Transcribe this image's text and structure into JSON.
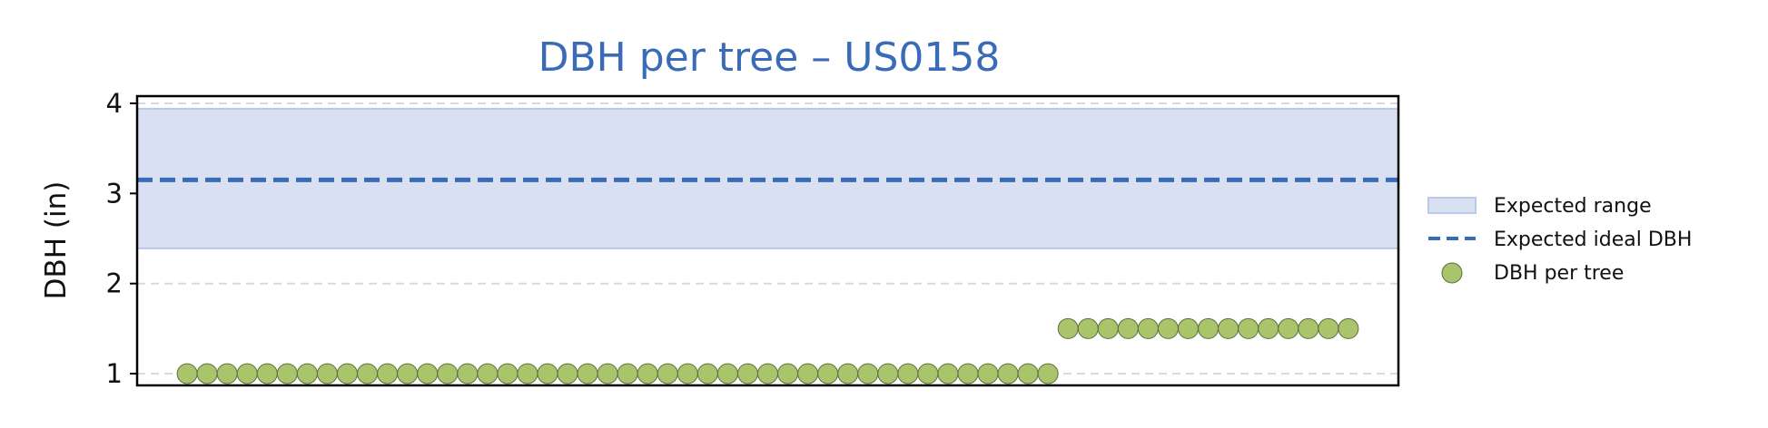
{
  "chart_data": {
    "type": "scatter",
    "title": "DBH per tree – US0158",
    "xlabel": "",
    "ylabel": "DBH (in)",
    "ylim": [
      0.87,
      4.08
    ],
    "xlim": [
      0.5,
      63.5
    ],
    "yticks": [
      1,
      2,
      3,
      4
    ],
    "xticks": [],
    "grid": "y",
    "expected_range": [
      2.39,
      3.94
    ],
    "expected_ideal": 3.15,
    "series": [
      {
        "name": "DBH per tree",
        "x": [
          3,
          4,
          5,
          6,
          7,
          8,
          9,
          10,
          11,
          12,
          13,
          14,
          15,
          16,
          17,
          18,
          19,
          20,
          21,
          22,
          23,
          24,
          25,
          26,
          27,
          28,
          29,
          30,
          31,
          32,
          33,
          34,
          35,
          36,
          37,
          38,
          39,
          40,
          41,
          42,
          43,
          44,
          45,
          46,
          47,
          48,
          49,
          50,
          51,
          52,
          53,
          54,
          55,
          56,
          57,
          58,
          59,
          60,
          61
        ],
        "y": [
          1,
          1,
          1,
          1,
          1,
          1,
          1,
          1,
          1,
          1,
          1,
          1,
          1,
          1,
          1,
          1,
          1,
          1,
          1,
          1,
          1,
          1,
          1,
          1,
          1,
          1,
          1,
          1,
          1,
          1,
          1,
          1,
          1,
          1,
          1,
          1,
          1,
          1,
          1,
          1,
          1,
          1,
          1,
          1,
          1.5,
          1.5,
          1.5,
          1.5,
          1.5,
          1.5,
          1.5,
          1.5,
          1.5,
          1.5,
          1.5,
          1.5,
          1.5,
          1.5,
          1.5
        ]
      }
    ],
    "legend": {
      "position": "center-right",
      "entries": [
        "Expected range",
        "Expected ideal DBH",
        "DBH per tree"
      ]
    },
    "colors": {
      "title": "#3a6bb8",
      "band_fill": "#d8e0f1",
      "band_edge": "#b8c9ea",
      "ideal_line": "#3a6bb8",
      "point_fill": "#a9c46b",
      "point_edge": "#5f6f3d",
      "grid": "#d9d9d9"
    }
  }
}
